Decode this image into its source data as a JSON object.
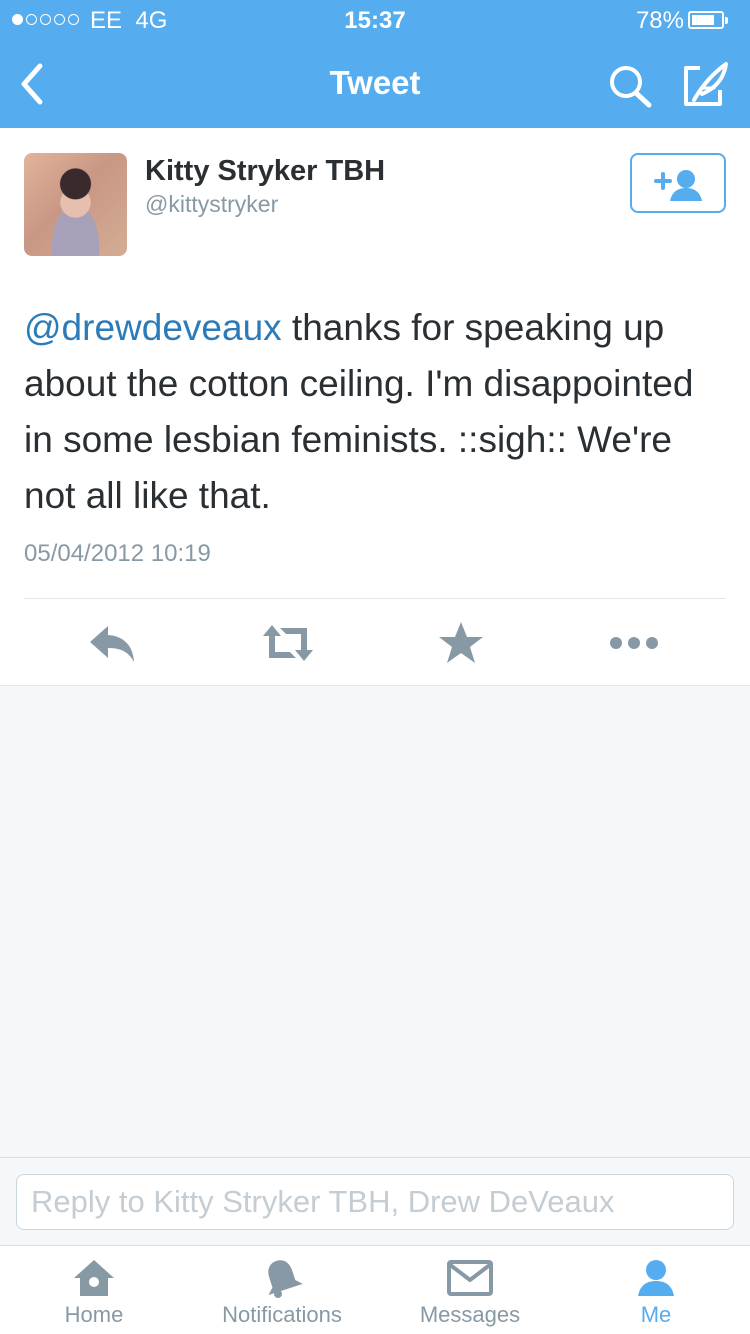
{
  "status_bar": {
    "carrier": "EE",
    "network": "4G",
    "time": "15:37",
    "battery_percent": "78%",
    "battery_level": 0.78,
    "signal_bars_filled": 1,
    "signal_bars_total": 5
  },
  "nav": {
    "title": "Tweet",
    "back_icon": "chevron-left-icon",
    "search_icon": "search-icon",
    "compose_icon": "compose-quill-icon"
  },
  "tweet": {
    "author_name": "Kitty Stryker TBH",
    "author_handle": "@kittystryker",
    "mention": "@drewdeveaux",
    "body": " thanks for speaking up about the cotton ceiling. I'm disappointed in some lesbian feminists. ::sigh:: We're not all like that.",
    "date": "05/04/2012 10:19",
    "follow_icon": "add-user-icon",
    "actions": {
      "reply_icon": "reply-icon",
      "retweet_icon": "retweet-icon",
      "favorite_icon": "star-icon",
      "more_icon": "more-dots-icon"
    }
  },
  "reply": {
    "placeholder": "Reply to Kitty Stryker TBH, Drew DeVeaux"
  },
  "tabbar": {
    "items": [
      {
        "label": "Home",
        "icon": "home-icon",
        "active": false
      },
      {
        "label": "Notifications",
        "icon": "bell-icon",
        "active": false
      },
      {
        "label": "Messages",
        "icon": "envelope-icon",
        "active": false
      },
      {
        "label": "Me",
        "icon": "person-icon",
        "active": true
      }
    ]
  },
  "colors": {
    "brand": "#55acee",
    "link": "#2b7bb9",
    "text": "#292f33",
    "muted": "#8899a6",
    "icon": "#8899a6",
    "background": "#f5f8fa"
  }
}
